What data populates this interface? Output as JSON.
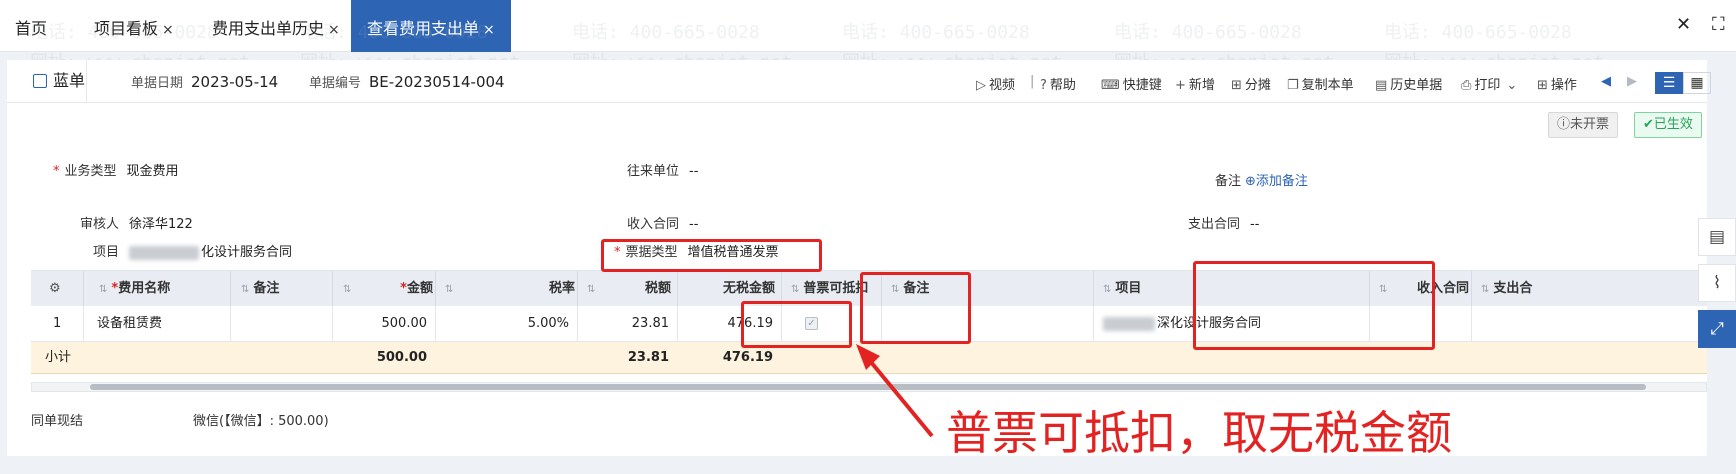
{
  "tabs": [
    {
      "label": "首页",
      "closable": false,
      "active": false
    },
    {
      "label": "项目看板",
      "closable": true,
      "active": false
    },
    {
      "label": "费用支出单历史",
      "closable": true,
      "active": false
    },
    {
      "label": "查看费用支出单",
      "closable": true,
      "active": true
    }
  ],
  "tab_close_glyph": "×",
  "window": {
    "close_glyph": "✕",
    "fullscreen_glyph": "⛶"
  },
  "doc": {
    "type_label": "蓝单",
    "date_label": "单据日期",
    "date_value": "2023-05-14",
    "number_label": "单据编号",
    "number_value": "BE-20230514-004"
  },
  "toolbar": {
    "video": "视频",
    "help": "帮助",
    "shortcut": "快捷键",
    "add": "新增",
    "split": "分摊",
    "copy": "复制本单",
    "history": "历史单据",
    "print": "打印",
    "operate": "操作",
    "separator": "|"
  },
  "status": {
    "invoice": "未开票",
    "effective": "已生效"
  },
  "form": {
    "business_type_label": "业务类型",
    "business_type_value": "现金费用",
    "partner_label": "往来单位",
    "partner_value": "--",
    "remark_label": "备注",
    "add_remark": "添加备注",
    "reviewer_label": "审核人",
    "reviewer_value": "徐泽华122",
    "income_contract_label": "收入合同",
    "income_contract_value": "--",
    "expense_contract_label": "支出合同",
    "expense_contract_value": "--",
    "project_label": "项目",
    "project_value_suffix": "化设计服务合同",
    "invoice_type_label": "票据类型",
    "invoice_type_value": "增值税普通发票"
  },
  "grid": {
    "headers": {
      "name": "费用名称",
      "remark": "备注",
      "amount": "金额",
      "tax_rate": "税率",
      "tax": "税额",
      "net": "无税金额",
      "deductible": "普票可抵扣",
      "remark2": "备注",
      "project": "项目",
      "income_contract": "收入合同",
      "expense_contract": "支出合"
    },
    "rows": [
      {
        "index": "1",
        "name": "设备租赁费",
        "amount": "500.00",
        "tax_rate": "5.00%",
        "tax": "23.81",
        "net": "476.19",
        "deductible": true,
        "project_suffix": "深化设计服务合同"
      }
    ],
    "subtotal": {
      "label": "小计",
      "amount": "500.00",
      "tax": "23.81",
      "net": "476.19"
    }
  },
  "footer": {
    "settle_label": "同单现结",
    "settle_value": "微信(【微信】: 500.00)"
  },
  "annotation": "普票可抵扣，取无税金额",
  "watermark": {
    "phone": "电话: 400-665-0028",
    "site": "网址: www.chanjet.net"
  },
  "colors": {
    "accent": "#2d64b3",
    "annotation": "#e32222",
    "subtotal_bg": "#fdf3de"
  }
}
